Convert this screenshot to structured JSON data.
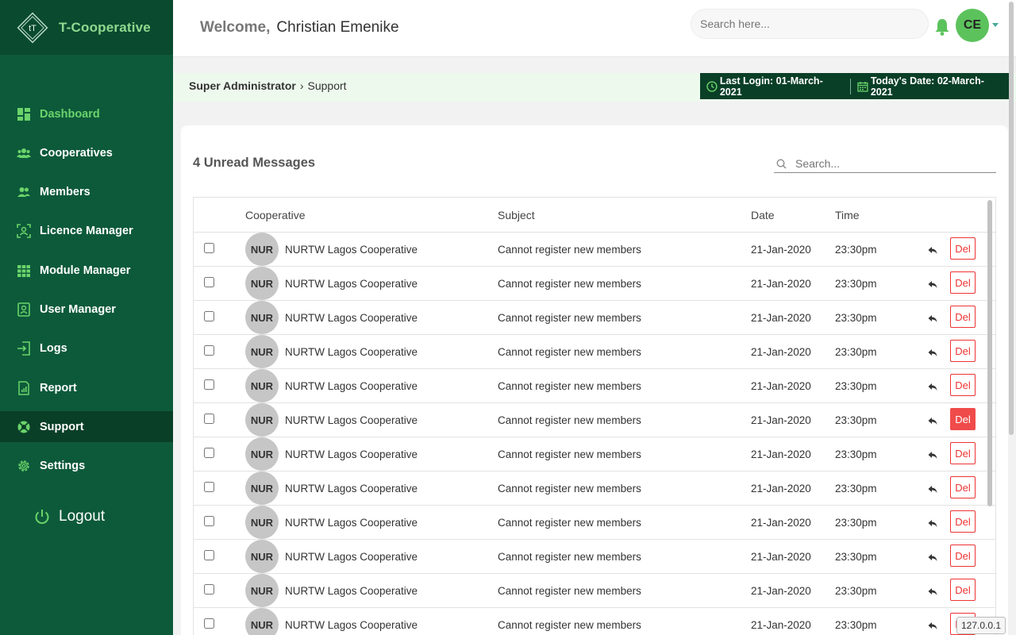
{
  "app": {
    "name": "T-Cooperative"
  },
  "header": {
    "welcome_label": "Welcome,",
    "user_name": "Christian Emenike",
    "search_placeholder": "Search here...",
    "avatar_initials": "CE"
  },
  "sidebar": {
    "items": [
      {
        "label": "Dashboard",
        "icon": "dashboard-icon"
      },
      {
        "label": "Cooperatives",
        "icon": "users-group-icon"
      },
      {
        "label": "Members",
        "icon": "users-icon"
      },
      {
        "label": "Licence Manager",
        "icon": "licence-icon"
      },
      {
        "label": "Module Manager",
        "icon": "grid-icon"
      },
      {
        "label": "User Manager",
        "icon": "user-badge-icon"
      },
      {
        "label": "Logs",
        "icon": "login-icon"
      },
      {
        "label": "Report",
        "icon": "report-icon"
      },
      {
        "label": "Support",
        "icon": "lifebuoy-icon"
      },
      {
        "label": "Settings",
        "icon": "gear-icon"
      }
    ],
    "logout_label": "Logout"
  },
  "breadcrumb": {
    "root": "Super Administrator",
    "separator": "›",
    "current": "Support"
  },
  "info": {
    "last_login": "Last Login: 01-March-2021",
    "todays_date": "Today's Date: 02-March-2021"
  },
  "messages": {
    "unread_title": "4 Unread Messages",
    "search_placeholder": "Search...",
    "columns": {
      "cooperative": "Cooperative",
      "subject": "Subject",
      "date": "Date",
      "time": "Time"
    },
    "rows": [
      {
        "badge": "NUR",
        "cooperative": "NURTW Lagos Cooperative",
        "subject": "Cannot register new members",
        "date": "21-Jan-2020",
        "time": "23:30pm",
        "del": "Del"
      },
      {
        "badge": "NUR",
        "cooperative": "NURTW Lagos Cooperative",
        "subject": "Cannot register new members",
        "date": "21-Jan-2020",
        "time": "23:30pm",
        "del": "Del"
      },
      {
        "badge": "NUR",
        "cooperative": "NURTW Lagos Cooperative",
        "subject": "Cannot register new members",
        "date": "21-Jan-2020",
        "time": "23:30pm",
        "del": "Del"
      },
      {
        "badge": "NUR",
        "cooperative": "NURTW Lagos Cooperative",
        "subject": "Cannot register new members",
        "date": "21-Jan-2020",
        "time": "23:30pm",
        "del": "Del"
      },
      {
        "badge": "NUR",
        "cooperative": "NURTW Lagos Cooperative",
        "subject": "Cannot register new members",
        "date": "21-Jan-2020",
        "time": "23:30pm",
        "del": "Del"
      },
      {
        "badge": "NUR",
        "cooperative": "NURTW Lagos Cooperative",
        "subject": "Cannot register new members",
        "date": "21-Jan-2020",
        "time": "23:30pm",
        "del": "Del"
      },
      {
        "badge": "NUR",
        "cooperative": "NURTW Lagos Cooperative",
        "subject": "Cannot register new members",
        "date": "21-Jan-2020",
        "time": "23:30pm",
        "del": "Del"
      },
      {
        "badge": "NUR",
        "cooperative": "NURTW Lagos Cooperative",
        "subject": "Cannot register new members",
        "date": "21-Jan-2020",
        "time": "23:30pm",
        "del": "Del"
      },
      {
        "badge": "NUR",
        "cooperative": "NURTW Lagos Cooperative",
        "subject": "Cannot register new members",
        "date": "21-Jan-2020",
        "time": "23:30pm",
        "del": "Del"
      },
      {
        "badge": "NUR",
        "cooperative": "NURTW Lagos Cooperative",
        "subject": "Cannot register new members",
        "date": "21-Jan-2020",
        "time": "23:30pm",
        "del": "Del"
      },
      {
        "badge": "NUR",
        "cooperative": "NURTW Lagos Cooperative",
        "subject": "Cannot register new members",
        "date": "21-Jan-2020",
        "time": "23:30pm",
        "del": "Del"
      },
      {
        "badge": "NUR",
        "cooperative": "NURTW Lagos Cooperative",
        "subject": "Cannot register new members",
        "date": "21-Jan-2020",
        "time": "23:30pm",
        "del": "Del"
      }
    ]
  },
  "status": {
    "host": "127.0.0.1"
  },
  "colors": {
    "sidebar": "#0d5a3a",
    "sidebar_dark": "#0a3f27",
    "accent_green": "#5cc25c",
    "danger": "#e33333"
  }
}
